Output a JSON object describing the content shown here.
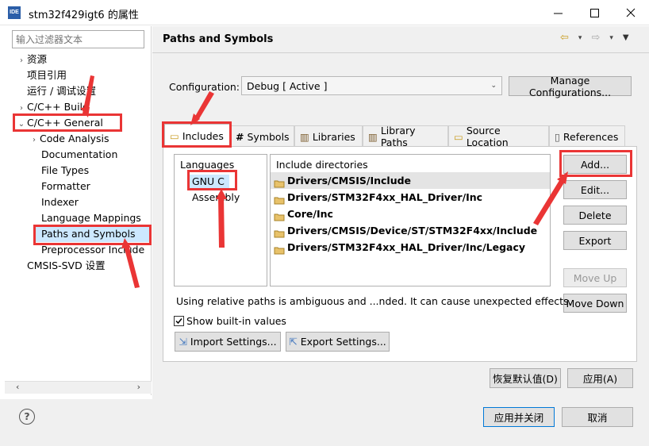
{
  "window": {
    "title": "stm32f429igt6 的属性",
    "app_icon_label": "IDE"
  },
  "filter": {
    "placeholder": "输入过滤器文本"
  },
  "tree": [
    {
      "label": "资源",
      "arrow": "›"
    },
    {
      "label": "项目引用",
      "arrow": ""
    },
    {
      "label": "运行 / 调试设置",
      "arrow": ""
    },
    {
      "label": "C/C++ Build",
      "arrow": "›"
    },
    {
      "label": "C/C++ General",
      "arrow": "⌄"
    },
    {
      "label": "Code Analysis",
      "arrow": "›"
    },
    {
      "label": "Documentation",
      "arrow": ""
    },
    {
      "label": "File Types",
      "arrow": ""
    },
    {
      "label": "Formatter",
      "arrow": ""
    },
    {
      "label": "Indexer",
      "arrow": ""
    },
    {
      "label": "Language Mappings",
      "arrow": ""
    },
    {
      "label": "Paths and Symbols",
      "arrow": ""
    },
    {
      "label": "Preprocessor Include",
      "arrow": ""
    },
    {
      "label": "CMSIS-SVD 设置",
      "arrow": ""
    }
  ],
  "page": {
    "title": "Paths and Symbols"
  },
  "configuration": {
    "label": "Configuration:",
    "value": "Debug  [ Active ]",
    "manage_label": "Manage Configurations..."
  },
  "tabs": [
    "Includes",
    "Symbols",
    "Libraries",
    "Library Paths",
    "Source Location",
    "References"
  ],
  "languages": {
    "header": "Languages",
    "items": [
      "GNU C",
      "Assembly"
    ]
  },
  "includes": {
    "header": "Include directories",
    "items": [
      "Drivers/CMSIS/Include",
      "Drivers/STM32F4xx_HAL_Driver/Inc",
      "Core/Inc",
      "Drivers/CMSIS/Device/ST/STM32F4xx/Include",
      "Drivers/STM32F4xx_HAL_Driver/Inc/Legacy"
    ]
  },
  "side_buttons": {
    "add": "Add...",
    "edit": "Edit...",
    "delete": "Delete",
    "export": "Export",
    "move_up": "Move Up",
    "move_down": "Move Down"
  },
  "warning": "Using relative paths is ambiguous and ...nded. It can cause unexpected effects.",
  "show_builtin": {
    "label": "Show built-in values",
    "checked": true
  },
  "import_settings": "Import Settings...",
  "export_settings": "Export Settings...",
  "restore_defaults": "恢复默认值(D)",
  "apply": "应用(A)",
  "apply_close": "应用并关闭",
  "cancel": "取消",
  "colors": {
    "annotation": "#ea3535",
    "selection": "#cce8ff",
    "accent": "#0078d7"
  }
}
